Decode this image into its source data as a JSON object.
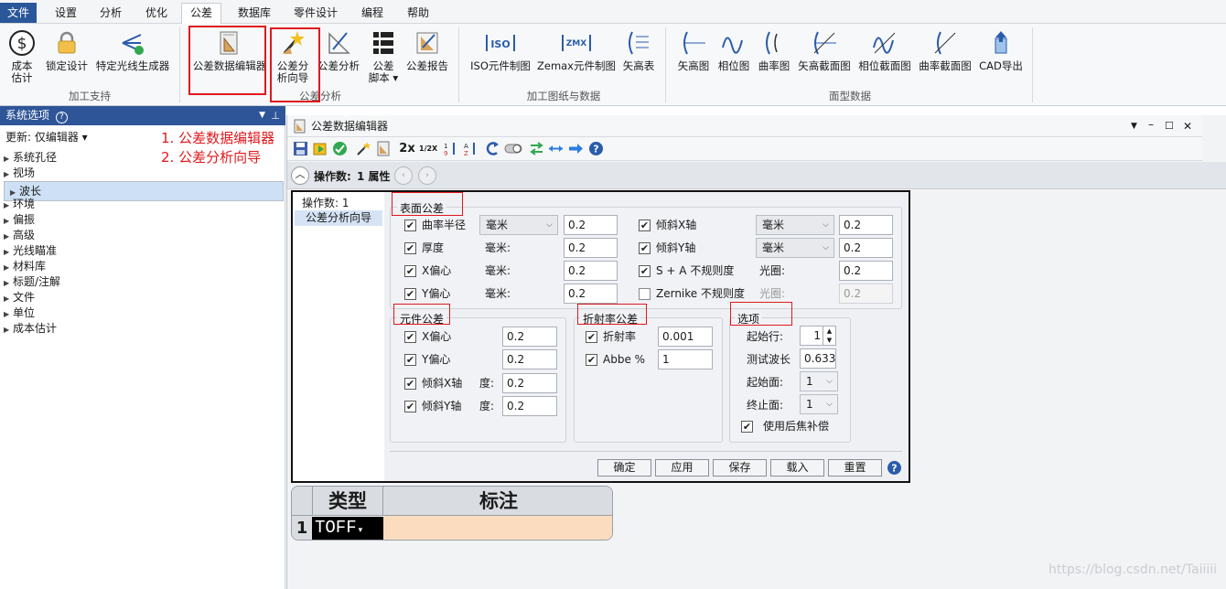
{
  "menu": {
    "items": [
      "文件",
      "设置",
      "分析",
      "优化",
      "公差",
      "数据库",
      "零件设计",
      "编程",
      "帮助"
    ]
  },
  "ribbon": {
    "groups": [
      {
        "label": "加工支持",
        "buttons": [
          "成本\n估计",
          "锁定设计",
          "特定光线生成器"
        ]
      },
      {
        "label": "公差分析",
        "buttons": [
          "公差数据编辑器",
          "公差分\n析向导",
          "公差分析",
          "公差\n脚本 ▾",
          "公差报告"
        ]
      },
      {
        "label": "加工图纸与数据",
        "buttons": [
          "ISO元件制图",
          "Zemax元件制图",
          "矢高表"
        ]
      },
      {
        "label": "面型数据",
        "buttons": [
          "矢高图",
          "相位图",
          "曲率图",
          "矢高截面图",
          "相位截面图",
          "曲率截面图",
          "CAD导出"
        ]
      }
    ]
  },
  "left_panel": {
    "title": "系统选项",
    "help_icon": "?",
    "update_label": "更新: 仅编辑器 ▾",
    "items": [
      "系统孔径",
      "视场",
      "波长",
      "环境",
      "偏振",
      "高级",
      "光线瞄准",
      "材料库",
      "标题/注解",
      "文件",
      "单位",
      "成本估计"
    ],
    "selected_index": 2
  },
  "annotations": [
    "1. 公差数据编辑器",
    "2. 公差分析向导"
  ],
  "editor": {
    "title": "公差数据编辑器",
    "toolbar_text": [
      "2x",
      "1/2X"
    ],
    "operand_label": "操作数:",
    "operand_value": "1 属性",
    "list": {
      "header": "操作数: 1",
      "item": "公差分析向导"
    },
    "surface_tol": {
      "title": "表面公差",
      "left_rows": [
        {
          "label": "曲率半径",
          "checked": true,
          "unit": "毫米",
          "unit_is_dropdown": true,
          "value": "0.2"
        },
        {
          "label": "厚度",
          "checked": true,
          "unit": "毫米:",
          "unit_is_dropdown": false,
          "value": "0.2"
        },
        {
          "label": "X偏心",
          "checked": true,
          "unit": "毫米:",
          "unit_is_dropdown": false,
          "value": "0.2"
        },
        {
          "label": "Y偏心",
          "checked": true,
          "unit": "毫米:",
          "unit_is_dropdown": false,
          "value": "0.2"
        }
      ],
      "right_rows": [
        {
          "label": "倾斜X轴",
          "checked": true,
          "unit": "毫米",
          "unit_is_dropdown": true,
          "value": "0.2"
        },
        {
          "label": "倾斜Y轴",
          "checked": true,
          "unit": "毫米",
          "unit_is_dropdown": true,
          "value": "0.2"
        },
        {
          "label": "S + A 不规则度",
          "checked": true,
          "unit": "光圈:",
          "unit_is_dropdown": false,
          "value": "0.2"
        },
        {
          "label": "Zernike 不规则度",
          "checked": false,
          "unit": "光圈:",
          "unit_is_dropdown": false,
          "value": "0.2"
        }
      ]
    },
    "element_tol": {
      "title": "元件公差",
      "rows": [
        {
          "label": "X偏心",
          "checked": true,
          "unit": "",
          "value": "0.2"
        },
        {
          "label": "Y偏心",
          "checked": true,
          "unit": "",
          "value": "0.2"
        },
        {
          "label": "倾斜X轴",
          "checked": true,
          "unit": "度:",
          "value": "0.2"
        },
        {
          "label": "倾斜Y轴",
          "checked": true,
          "unit": "度:",
          "value": "0.2"
        }
      ]
    },
    "index_tol": {
      "title": "折射率公差",
      "rows": [
        {
          "label": "折射率",
          "checked": true,
          "value": "0.001"
        },
        {
          "label": "Abbe %",
          "checked": true,
          "value": "1"
        }
      ]
    },
    "options": {
      "title": "选项",
      "start_row_label": "起始行:",
      "start_row_value": "1",
      "test_wave_label": "测试波长",
      "test_wave_value": "0.633",
      "start_surf_label": "起始面:",
      "start_surf_value": "1",
      "end_surf_label": "终止面:",
      "end_surf_value": "1",
      "back_focus_label": "使用后焦补偿",
      "back_focus_checked": true
    },
    "buttons": [
      "确定",
      "应用",
      "保存",
      "载入",
      "重置"
    ]
  },
  "table": {
    "headers": [
      "类型",
      "标注"
    ],
    "rows": [
      {
        "num": "1",
        "type": "TOFF",
        "note": ""
      }
    ]
  },
  "watermark": "https://blog.csdn.net/Taiiiii"
}
